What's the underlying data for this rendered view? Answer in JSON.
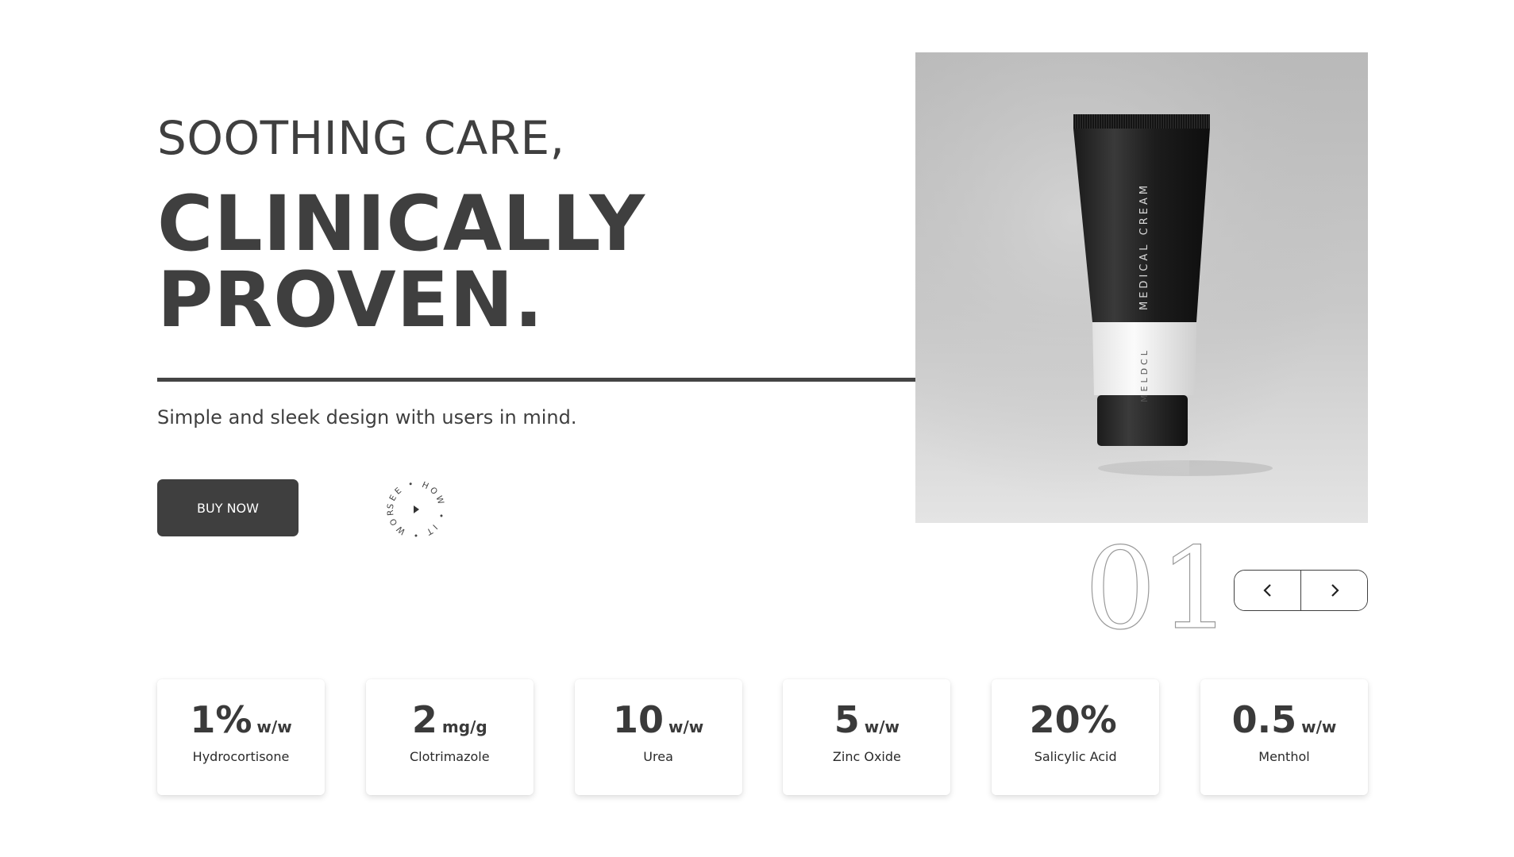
{
  "hero": {
    "subtitle": "SOOTHING CARE,",
    "title_line1": "CLINICALLY",
    "title_line2": "PROVEN.",
    "tagline": "Simple and sleek design with users in mind.",
    "buy_label": "BUY NOW",
    "how_it_works_label": "SEE • HOW • IT • WORKS •"
  },
  "product": {
    "tube_text_upper": "MEDICAL CREAM",
    "tube_text_lower": "MELDCL"
  },
  "slider": {
    "current": "01",
    "prev_icon": "chevron-left-icon",
    "next_icon": "chevron-right-icon"
  },
  "ingredients": [
    {
      "value": "1%",
      "unit": "w/w",
      "name": "Hydrocortisone"
    },
    {
      "value": "2",
      "unit": "mg/g",
      "name": "Clotrimazole"
    },
    {
      "value": "10",
      "unit": "w/w",
      "name": "Urea"
    },
    {
      "value": "5",
      "unit": "w/w",
      "name": "Zinc Oxide"
    },
    {
      "value": "20%",
      "unit": "",
      "name": "Salicylic Acid"
    },
    {
      "value": "0.5",
      "unit": "w/w",
      "name": "Menthol"
    }
  ],
  "colors": {
    "primary": "#3f3f3f",
    "background": "#ffffff",
    "image_background": "#c2c2c2"
  }
}
